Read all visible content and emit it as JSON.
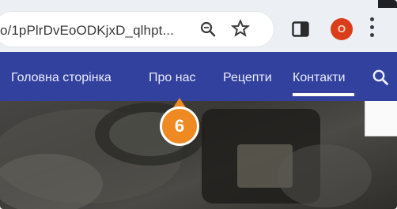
{
  "browser": {
    "url": "o/1pPlrDvEoODKjxD_qlhpt...",
    "profile_initial": "O"
  },
  "nav": {
    "items": [
      {
        "label": "Головна сторінка"
      },
      {
        "label": "Про нас"
      },
      {
        "label": "Рецепти"
      },
      {
        "label": "Контакти",
        "active": true
      }
    ]
  },
  "callout": {
    "number": "6"
  },
  "colors": {
    "nav_bg": "#33419e",
    "badge": "#ef8a22",
    "avatar": "#d93d1a"
  }
}
